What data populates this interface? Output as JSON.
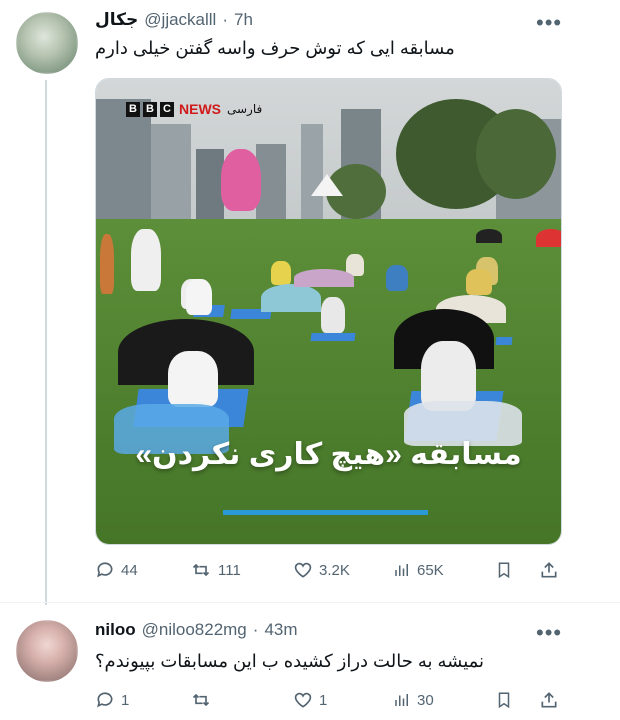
{
  "tweet1": {
    "display_name": "جکال",
    "handle": "@jjackalll",
    "separator": "·",
    "time": "7h",
    "more": "•••",
    "text": "مسابقه ایی که توش حرف واسه گفتن خیلی دارم",
    "media": {
      "brand_letters": [
        "B",
        "B",
        "C"
      ],
      "brand_news": "NEWS",
      "brand_lang": "فارسی",
      "caption": "مسابقه «هیچ کاری نکردن»"
    },
    "actions": {
      "replies": "44",
      "reposts": "111",
      "likes": "3.2K",
      "views": "65K"
    }
  },
  "tweet2": {
    "display_name": "niloo",
    "handle": "@niloo822mg",
    "separator": "·",
    "time": "43m",
    "more": "•••",
    "text": "نمیشه به حالت دراز کشیده ب این مسابقات بپیوندم؟",
    "actions": {
      "replies": "1",
      "reposts": "",
      "likes": "1",
      "views": "30"
    }
  },
  "colors": {
    "text": "#0f1419",
    "muted": "#536471",
    "brand_red": "#d11a1a",
    "caption_bar": "#2a9ad6"
  }
}
